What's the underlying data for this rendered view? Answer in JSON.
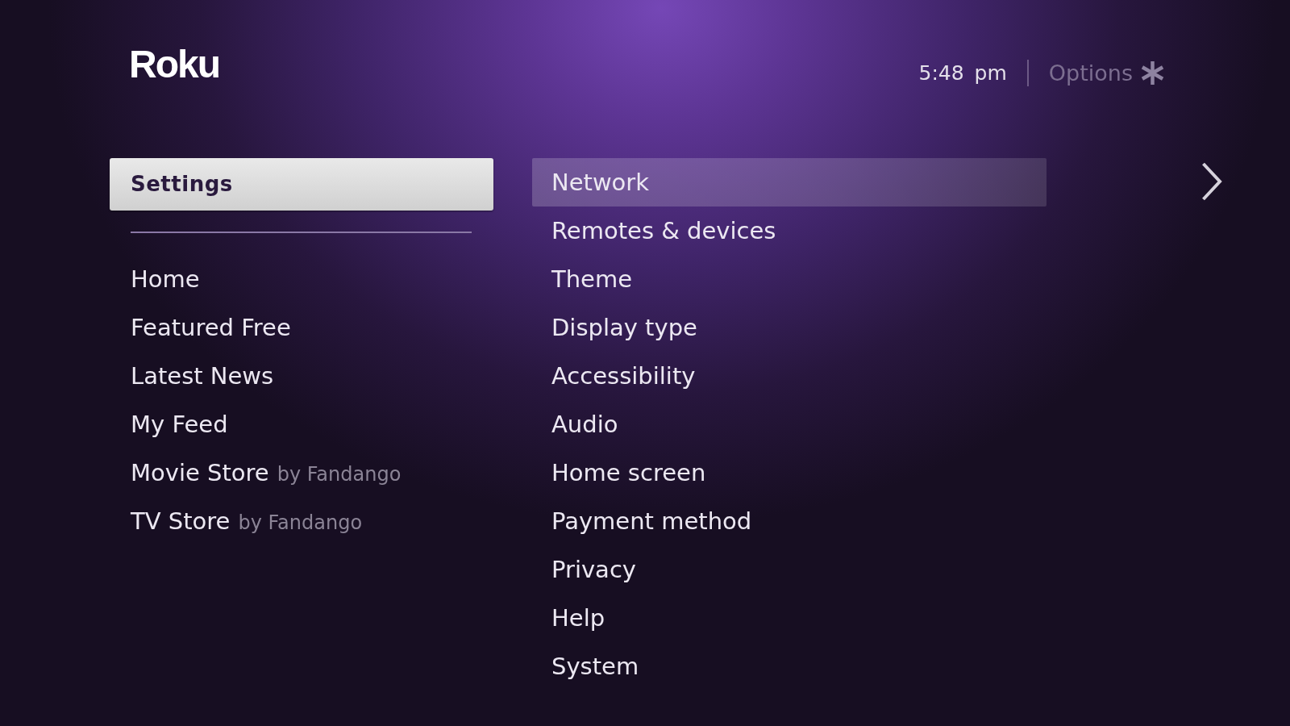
{
  "header": {
    "logo": "Roku",
    "time": "5:48 pm",
    "options_label": "Options"
  },
  "left_menu": {
    "items": [
      {
        "label": "Settings",
        "selected": true
      },
      {
        "label": "Home",
        "selected": false
      },
      {
        "label": "Featured Free",
        "selected": false
      },
      {
        "label": "Latest News",
        "selected": false
      },
      {
        "label": "My Feed",
        "selected": false
      },
      {
        "label": "Movie Store",
        "note": "by Fandango",
        "selected": false
      },
      {
        "label": "TV Store",
        "note": "by Fandango",
        "selected": false
      }
    ]
  },
  "right_menu": {
    "items": [
      {
        "label": "Network",
        "selected": true
      },
      {
        "label": "Remotes & devices",
        "selected": false
      },
      {
        "label": "Theme",
        "selected": false
      },
      {
        "label": "Display type",
        "selected": false
      },
      {
        "label": "Accessibility",
        "selected": false
      },
      {
        "label": "Audio",
        "selected": false
      },
      {
        "label": "Home screen",
        "selected": false
      },
      {
        "label": "Payment method",
        "selected": false
      },
      {
        "label": "Privacy",
        "selected": false
      },
      {
        "label": "Help",
        "selected": false
      },
      {
        "label": "System",
        "selected": false
      }
    ]
  }
}
